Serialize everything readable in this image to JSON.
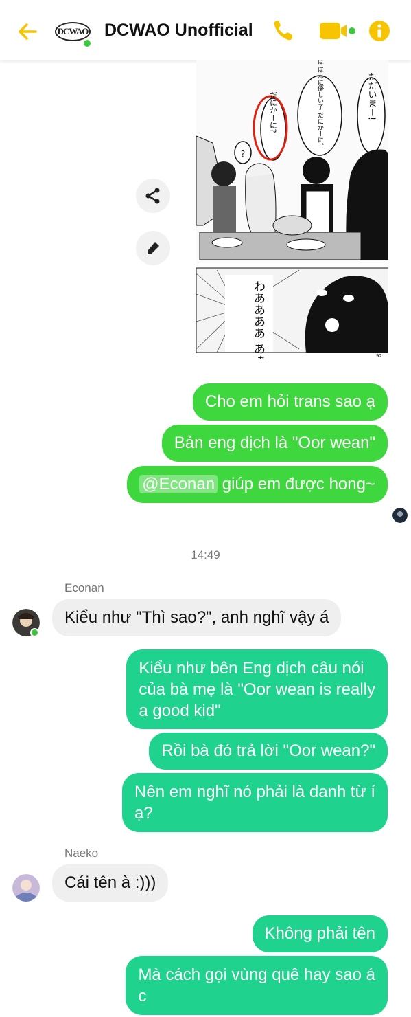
{
  "header": {
    "title": "DCWAO Unofficial",
    "logo_text": "DCWAO",
    "accent": "#f7c400",
    "online": "#3ec63e"
  },
  "messages": {
    "m1": "Cho em hỏi trans sao ạ",
    "m2": "Bản eng dịch là \"Oor wean\"",
    "m3_mention": "@Econan",
    "m3_rest": " giúp em được hong~",
    "time": "14:49",
    "sender1": "Econan",
    "m4": "Kiểu như \"Thì sao?\", anh nghĩ vậy á",
    "m5_l1": "Kiểu như bên Eng dịch câu nói",
    "m5_l2": "của bà mẹ là \"Oor wean is really",
    "m5_l3": "a good kid\"",
    "m6": "Rồi bà đó trả lời \"Oor wean?\"",
    "m7_l1": "Nên em nghĩ nó phải là danh từ í",
    "m7_l2": "ạ?",
    "sender2": "Naeko",
    "m8": "Cái tên à :)))",
    "m9": "Không phải tên",
    "m10_l1": "Mà cách gọi vùng quê hay sao á",
    "m10_l2": "c"
  },
  "manga": {
    "jp_bubble1": "ただいまー!",
    "jp_bubble2": "うちの子は ほんに優しい子 だにかーに。",
    "jp_bubble3": "だにかーに?",
    "jp_bubble4": "?",
    "jp_shout": "わああああ あぁ――!!",
    "page_no": "92"
  },
  "icons": {
    "back": "arrow-left-icon",
    "call": "phone-icon",
    "video": "video-camera-icon",
    "info": "info-icon",
    "share": "share-icon",
    "edit": "pencil-icon"
  }
}
